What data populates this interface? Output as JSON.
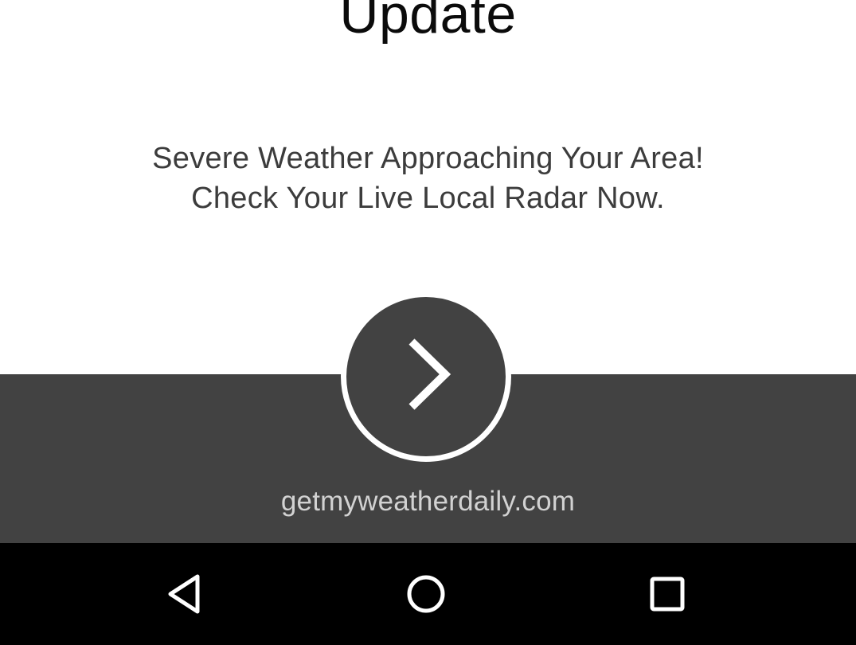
{
  "page": {
    "title": "Update",
    "message_lines": [
      "Severe Weather Approaching Your Area!",
      "Check Your Live Local Radar Now."
    ],
    "domain": "getmyweatherdaily.com"
  },
  "next_button": {
    "icon": "chevron-right-icon"
  },
  "nav_bar": {
    "back_icon": "back-triangle-icon",
    "home_icon": "home-circle-icon",
    "recents_icon": "recents-square-icon"
  },
  "colors": {
    "background": "#ffffff",
    "panel": "#424242",
    "nav_bar": "#000000",
    "title_text": "#0b0b0b",
    "message_text": "#3c3c3c",
    "domain_text": "#d2d2d2",
    "accent_ring": "#ffffff"
  }
}
